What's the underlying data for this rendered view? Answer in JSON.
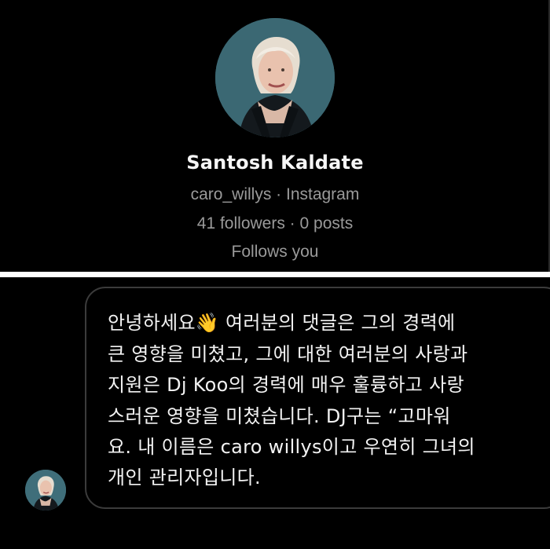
{
  "profile": {
    "name": "Santosh Kaldate",
    "username_line": "caro_willys · Instagram",
    "stats_line": "41 followers · 0 posts",
    "relationship": "Follows you",
    "avatar_icon": "profile-photo-woman"
  },
  "message": {
    "lines": [
      "안녕하세요👋 여러분의 댓글은 그의 경력에",
      "큰 영향을 미쳤고, 그에 대한 여러분의 사랑과",
      "지원은 Dj Koo의 경력에 매우 훌륭하고 사랑",
      "스러운 영향을 미쳤습니다. DJ구는 “고마워",
      "요. 내 이름은 caro willys이고 우연히 그녀의",
      "개인 관리자입니다."
    ]
  },
  "colors": {
    "background": "#000000",
    "separator": "#ffffff",
    "primary_text": "#f5f5f5",
    "secondary_text": "#9a9a9a",
    "bubble_border": "#3b3b3b",
    "avatar_bg": "#3e6b77"
  }
}
